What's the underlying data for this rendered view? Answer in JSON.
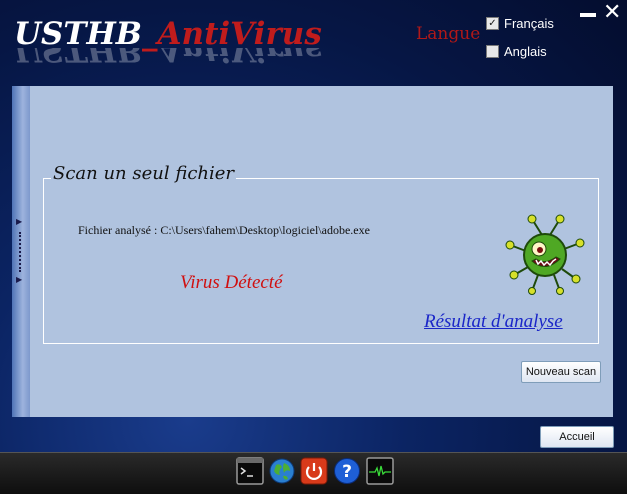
{
  "header": {
    "title_part1": "USTHB",
    "title_part2": "_AntiVirus",
    "language_label": "Langue",
    "languages": [
      {
        "label": "Français",
        "checked": true
      },
      {
        "label": "Anglais",
        "checked": false
      }
    ]
  },
  "scan": {
    "group_title": "Scan un seul fichier",
    "file_label": "Fichier analysé :",
    "file_path": "C:\\Users\\fahem\\Desktop\\logiciel\\adobe.exe",
    "status": "Virus Détecté",
    "result_link": "Résultat d'analyse",
    "new_scan_button": "Nouveau scan"
  },
  "footer": {
    "home_button": "Accueil"
  },
  "colors": {
    "title_accent": "#c01c1c",
    "panel_bg": "#b0c3df",
    "status_red": "#d01010",
    "link_blue": "#1a26c8"
  },
  "taskbar_icons": [
    "terminal-icon",
    "globe-icon",
    "power-icon",
    "help-icon",
    "monitor-icon"
  ]
}
